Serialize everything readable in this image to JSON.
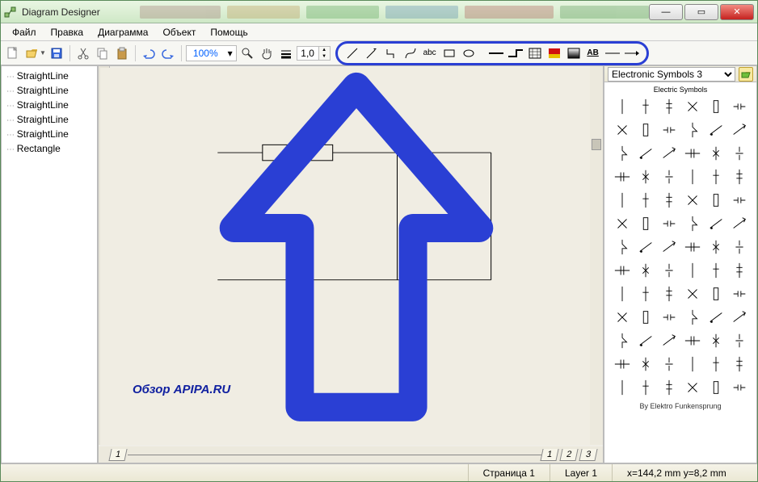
{
  "titlebar": {
    "title": "Diagram Designer"
  },
  "menu": [
    "Файл",
    "Правка",
    "Диаграмма",
    "Объект",
    "Помощь"
  ],
  "toolbar": {
    "zoom": "100%",
    "line_width": "1,0"
  },
  "tree": {
    "items": [
      "StraightLine",
      "StraightLine",
      "StraightLine",
      "StraightLine",
      "StraightLine",
      "Rectangle"
    ]
  },
  "palette": {
    "selected": "Electronic Symbols 3",
    "heading": "Electric Symbols",
    "credit": "By Elektro Funkensprung"
  },
  "canvas": {
    "watermark": "Обзор APIPA.RU",
    "page_tab_left": "1",
    "page_tabs_right": [
      "1",
      "2",
      "3"
    ]
  },
  "status": {
    "page": "Страница 1",
    "layer": "Layer 1",
    "coords": "x=144,2 mm  y=8,2 mm"
  }
}
